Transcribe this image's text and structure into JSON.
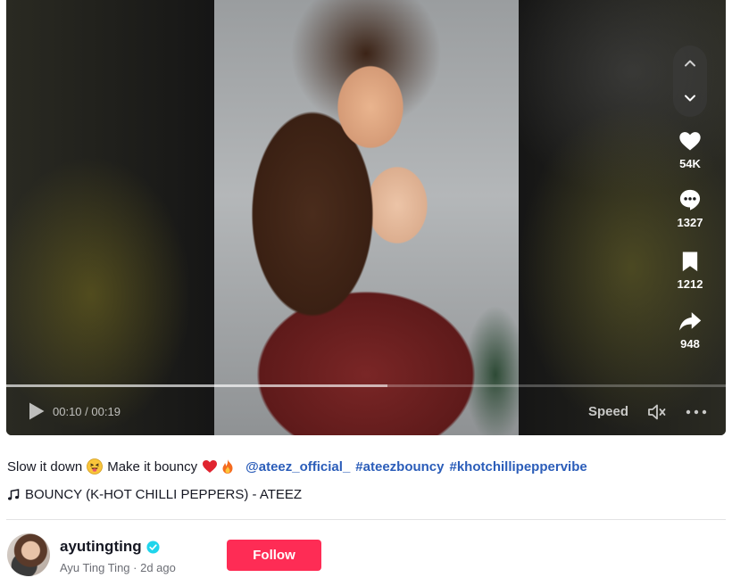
{
  "player": {
    "current_time": "00:10",
    "duration": "00:19",
    "time_separator": " / ",
    "progress": 0.53,
    "speed_label": "Speed"
  },
  "actions": {
    "likes": "54K",
    "comments": "1327",
    "saves": "1212",
    "shares": "948"
  },
  "caption": {
    "text1": "Slow it down",
    "text2": "Make it bouncy",
    "mention": "@ateez_official_",
    "hashtag1": "#ateezbouncy",
    "hashtag2": "#khotchillipeppervibe"
  },
  "music": {
    "title": "BOUNCY (K-HOT CHILLI PEPPERS) - ATEEZ"
  },
  "author": {
    "username": "ayutingting",
    "display_name": "Ayu Ting Ting",
    "posted": "2d ago",
    "follow_label": "Follow"
  },
  "icons": [
    "chevron-up-icon",
    "chevron-down-icon",
    "heart-icon",
    "comment-icon",
    "bookmark-icon",
    "share-icon",
    "play-icon",
    "volume-icon",
    "more-icon",
    "music-note-icon",
    "verified-icon"
  ],
  "colors": {
    "follow": "#fe2c55",
    "link": "#2b5db9",
    "verified": "#20d5ec"
  }
}
